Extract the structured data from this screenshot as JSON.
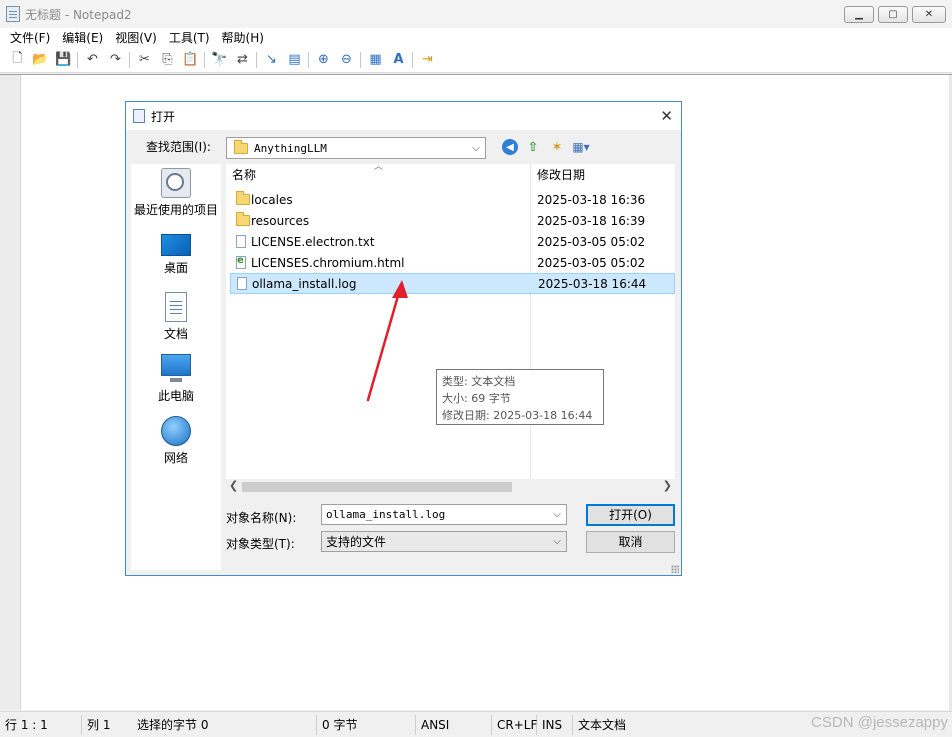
{
  "window": {
    "title": "无标题 - Notepad2",
    "controls": [
      "minimize",
      "maximize",
      "close"
    ]
  },
  "menu": [
    "文件(F)",
    "编辑(E)",
    "视图(V)",
    "工具(T)",
    "帮助(H)"
  ],
  "toolbar_icons": [
    "new-file-icon",
    "open-icon",
    "save-icon",
    "undo-icon",
    "redo-icon",
    "cut-icon",
    "copy-icon",
    "paste-icon",
    "find-icon",
    "replace-icon",
    "wordwrap-icon",
    "settings-icon",
    "zoom-in-icon",
    "zoom-out-icon",
    "schema-icon",
    "font-icon",
    "exit-icon"
  ],
  "dialog": {
    "title": "打开",
    "look_in_label": "查找范围(I):",
    "look_in_value": "AnythingLLM",
    "places": [
      "最近使用的项目",
      "桌面",
      "文档",
      "此电脑",
      "网络"
    ],
    "columns": [
      "名称",
      "修改日期"
    ],
    "files": [
      {
        "name": "locales",
        "date": "2025-03-18 16:36",
        "icon": "folder-icon",
        "selected": false
      },
      {
        "name": "resources",
        "date": "2025-03-18 16:39",
        "icon": "folder-icon",
        "selected": false
      },
      {
        "name": "LICENSE.electron.txt",
        "date": "2025-03-05 05:02",
        "icon": "text-file-icon",
        "selected": false
      },
      {
        "name": "LICENSES.chromium.html",
        "date": "2025-03-05 05:02",
        "icon": "html-file-icon",
        "selected": false
      },
      {
        "name": "ollama_install.log",
        "date": "2025-03-18 16:44",
        "icon": "text-file-icon",
        "selected": true
      }
    ],
    "tooltip": {
      "type_line": "类型: 文本文档",
      "size_line": "大小: 69​ 字节",
      "date_line": "修改日期: 2025-03-18 16:44"
    },
    "filename_label": "对象名称(N):",
    "filename_value": "ollama_install.log",
    "filetype_label": "对象类型(T):",
    "filetype_value": "支持的文件",
    "open_button": "打开(O)",
    "cancel_button": "取消"
  },
  "statusbar": {
    "position": "行 1 : 1",
    "column": "列 1",
    "selection": "选择的字节 0",
    "bytes": "0 字节",
    "encoding": "ANSI",
    "line_ending": "CR+LF",
    "mode": "INS",
    "scheme": "文本文档"
  },
  "watermark": "CSDN @jessezappy",
  "colors": {
    "accent": "#0078d7",
    "selection": "#cce8ff",
    "arrow": "#e0202a"
  }
}
